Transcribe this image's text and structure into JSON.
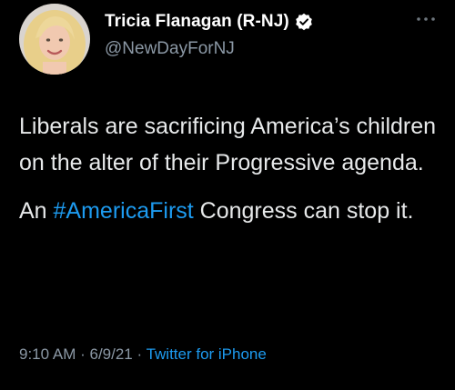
{
  "author": {
    "display_name": "Tricia Flanagan (R-NJ)",
    "handle": "@NewDayForNJ",
    "verified": true
  },
  "tweet": {
    "line1_text": "Liberals are sacrificing America’s children on the alter of their Progressive agenda.",
    "line2_prefix": "An ",
    "hashtag": "#AmericaFirst",
    "line2_suffix": " Congress can stop it."
  },
  "meta": {
    "time": "9:10 AM",
    "separator1": " · ",
    "date": "6/9/21",
    "separator2": " · ",
    "source": "Twitter for iPhone"
  },
  "icons": {
    "verified": "verified-badge-icon",
    "more": "more-options-icon"
  },
  "colors": {
    "background": "#000000",
    "text": "#e7e9ea",
    "secondary_text": "#8b98a5",
    "link": "#1d9bf0"
  }
}
